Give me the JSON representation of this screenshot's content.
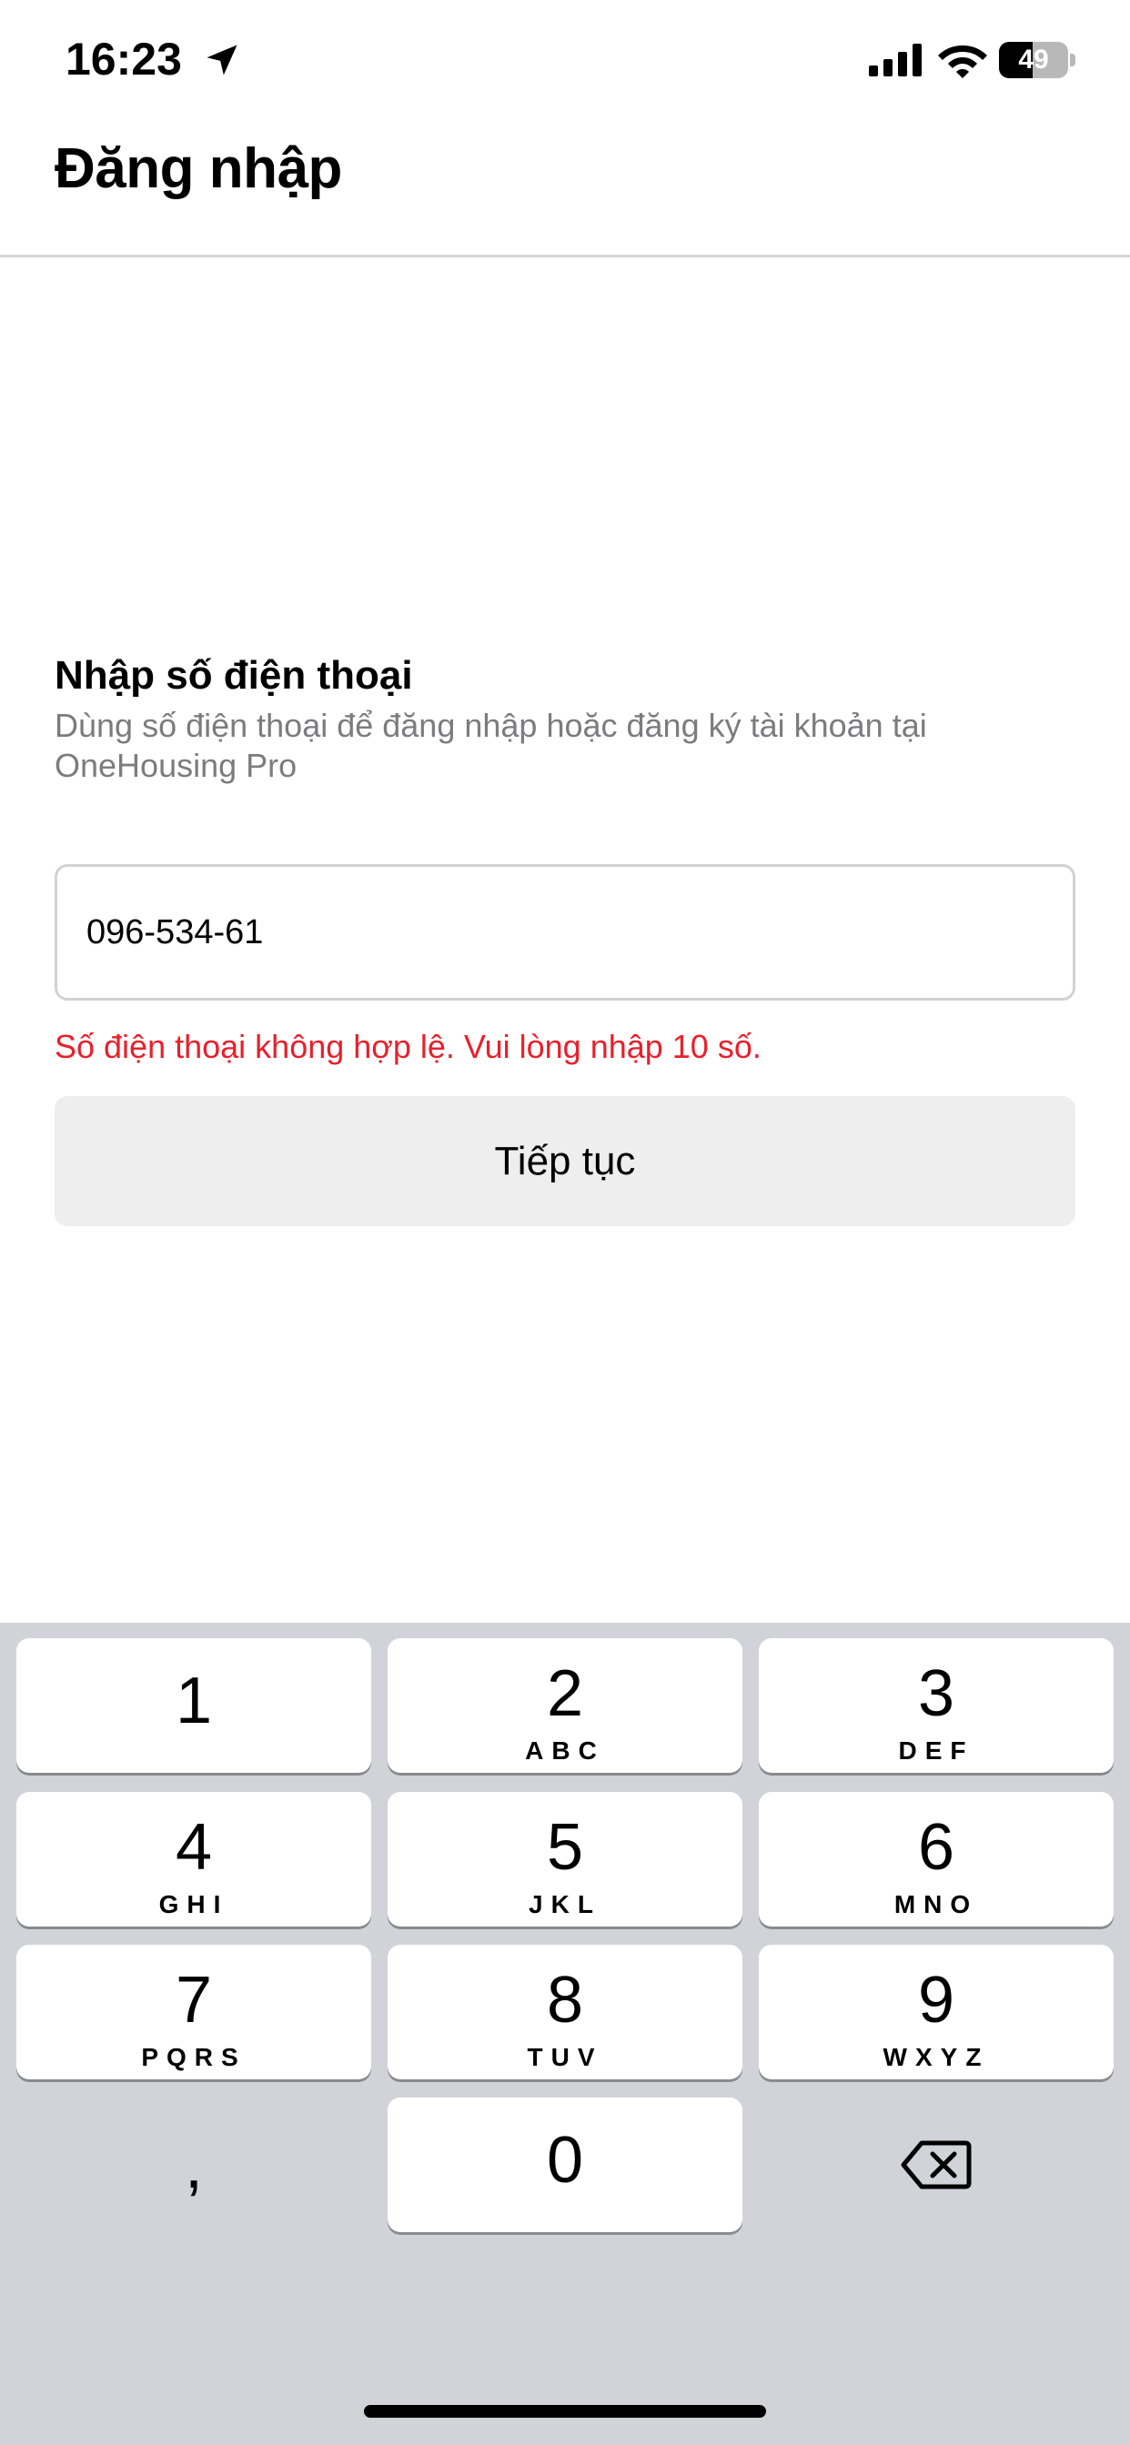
{
  "status_bar": {
    "time": "16:23",
    "battery_level": "49",
    "battery_fraction": 0.49,
    "icons": [
      "location-arrow-icon",
      "cellular-signal-icon",
      "wifi-icon",
      "battery-icon"
    ]
  },
  "header": {
    "title": "Đăng nhập"
  },
  "form": {
    "title": "Nhập số điện thoại",
    "description": "Dùng số điện thoại để đăng nhập hoặc đăng ký tài khoản tại OneHousing Pro",
    "phone_value": "096-534-61",
    "error": "Số điện thoại không hợp lệ. Vui lòng nhập 10 số.",
    "continue_label": "Tiếp tục",
    "error_color": "#e8202c",
    "button_color": "#eeeeee"
  },
  "keypad": {
    "keys": [
      {
        "digit": "1",
        "letters": ""
      },
      {
        "digit": "2",
        "letters": "ABC"
      },
      {
        "digit": "3",
        "letters": "DEF"
      },
      {
        "digit": "4",
        "letters": "GHI"
      },
      {
        "digit": "5",
        "letters": "JKL"
      },
      {
        "digit": "6",
        "letters": "MNO"
      },
      {
        "digit": "7",
        "letters": "PQRS"
      },
      {
        "digit": "8",
        "letters": "TUV"
      },
      {
        "digit": "9",
        "letters": "WXYZ"
      },
      {
        "digit": "0",
        "letters": ""
      }
    ],
    "comma": ",",
    "delete_icon": "delete-backspace-icon"
  }
}
